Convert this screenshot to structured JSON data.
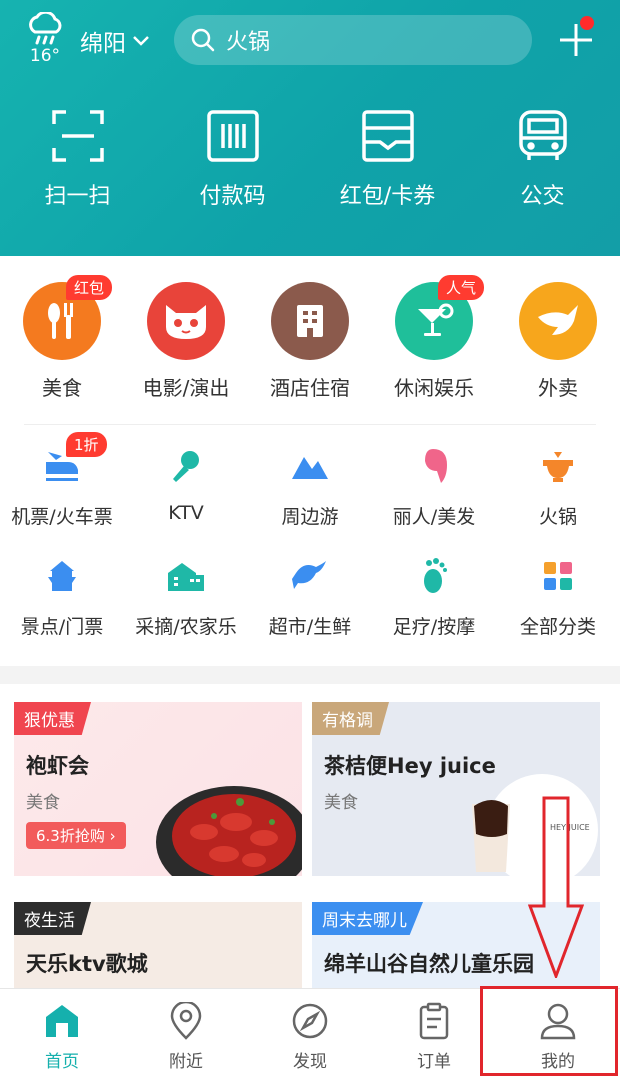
{
  "header": {
    "temperature": "16°",
    "city": "绵阳",
    "search_text": "火锅",
    "quick_actions": [
      {
        "label": "扫一扫",
        "icon": "scan-icon"
      },
      {
        "label": "付款码",
        "icon": "barcode-icon"
      },
      {
        "label": "红包/卡券",
        "icon": "coupon-icon"
      },
      {
        "label": "公交",
        "icon": "bus-icon"
      }
    ]
  },
  "categories": {
    "primary": [
      {
        "label": "美食",
        "badge": "红包",
        "color": "#f47a1f",
        "icon": "food-icon"
      },
      {
        "label": "电影/演出",
        "badge": "",
        "color": "#e8443a",
        "icon": "cat-icon"
      },
      {
        "label": "酒店住宿",
        "badge": "",
        "color": "#8b5a4c",
        "icon": "hotel-icon"
      },
      {
        "label": "休闲娱乐",
        "badge": "人气",
        "color": "#1fbf9a",
        "icon": "cocktail-icon"
      },
      {
        "label": "外卖",
        "badge": "",
        "color": "#f7a61c",
        "icon": "delivery-icon"
      }
    ],
    "secondary": [
      {
        "label": "机票/火车票",
        "badge": "1折",
        "icon": "train-icon"
      },
      {
        "label": "KTV",
        "badge": "",
        "icon": "microphone-icon"
      },
      {
        "label": "周边游",
        "badge": "",
        "icon": "mountain-icon"
      },
      {
        "label": "丽人/美发",
        "badge": "",
        "icon": "beauty-icon"
      },
      {
        "label": "火锅",
        "badge": "",
        "icon": "hotpot-icon"
      }
    ],
    "tertiary": [
      {
        "label": "景点/门票",
        "icon": "pagoda-icon"
      },
      {
        "label": "采摘/农家乐",
        "icon": "farm-icon"
      },
      {
        "label": "超市/生鲜",
        "icon": "fish-icon"
      },
      {
        "label": "足疗/按摩",
        "icon": "footprint-icon"
      },
      {
        "label": "全部分类",
        "icon": "grid-icon"
      }
    ]
  },
  "promos": [
    {
      "tag": "狠优惠",
      "tag_color": "#f0454f",
      "title": "袍虾会",
      "subtitle": "美食",
      "deal": "6.3折抢购 ›"
    },
    {
      "tag": "有格调",
      "tag_color": "#c9a77a",
      "title": "茶桔便Hey juice",
      "subtitle": "美食",
      "deal": ""
    },
    {
      "tag": "夜生活",
      "tag_color": "#2d2d2d",
      "title": "天乐ktv歌城",
      "subtitle": "",
      "deal": ""
    },
    {
      "tag": "周末去哪儿",
      "tag_color": "#3c8ff0",
      "title": "绵羊山谷自然儿童乐园",
      "subtitle": "",
      "deal": ""
    }
  ],
  "tabbar": [
    {
      "label": "首页",
      "icon": "home-icon",
      "active": true
    },
    {
      "label": "附近",
      "icon": "location-icon",
      "active": false
    },
    {
      "label": "发现",
      "icon": "compass-icon",
      "active": false
    },
    {
      "label": "订单",
      "icon": "clipboard-icon",
      "active": false
    },
    {
      "label": "我的",
      "icon": "user-icon",
      "active": false
    }
  ],
  "colors": {
    "brand": "#15b0ad",
    "annotation": "#e1262c"
  }
}
